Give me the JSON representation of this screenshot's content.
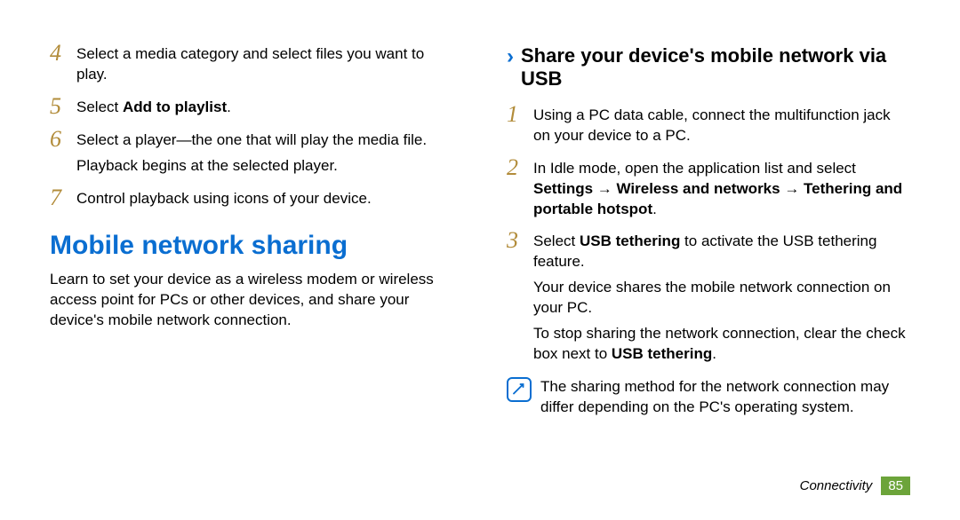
{
  "left": {
    "steps": [
      {
        "num": "4",
        "html": "Select a media category and select files you want to play."
      },
      {
        "num": "5",
        "html": "Select <b>Add to playlist</b>."
      },
      {
        "num": "6",
        "html": "Select a player—the one that will play the media file."
      },
      {
        "num": "7",
        "html": "Control playback using icons of your device."
      }
    ],
    "after6": "Playback begins at the selected player.",
    "h_blue": "Mobile network sharing",
    "intro": "Learn to set your device as a wireless modem or wireless access point for PCs or other devices, and share your device's mobile network connection."
  },
  "right": {
    "h_sub": "Share your device's mobile network via USB",
    "steps": [
      {
        "num": "1",
        "html": "Using a PC data cable, connect the multifunction jack on your device to a PC."
      },
      {
        "num": "2",
        "html": "In Idle mode, open the application list and select <b>Settings</b> → <b>Wireless and networks</b> → <b>Tethering and portable hotspot</b>."
      },
      {
        "num": "3",
        "html": "Select <b>USB tethering</b> to activate the USB tethering feature."
      }
    ],
    "after3a": "Your device shares the mobile network connection on your PC.",
    "after3b": "To stop sharing the network connection, clear the check box next to <b>USB tethering</b>.",
    "note": "The sharing method for the network connection may differ depending on the PC's operating system."
  },
  "footer": {
    "section": "Connectivity",
    "page": "85"
  }
}
